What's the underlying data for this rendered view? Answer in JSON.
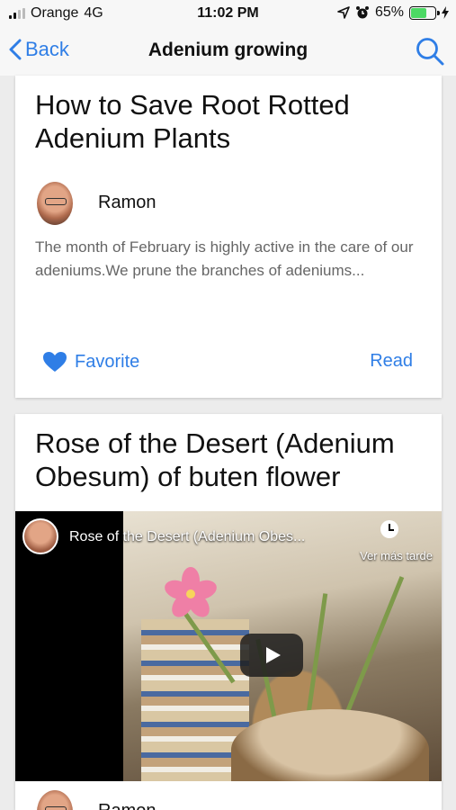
{
  "status_bar": {
    "carrier": "Orange",
    "network": "4G",
    "time": "11:02 PM",
    "battery_percent": "65%",
    "battery_level": 0.65
  },
  "nav": {
    "back_label": "Back",
    "title": "Adenium growing",
    "accent_color": "#2f7ee6"
  },
  "articles": [
    {
      "title": "How to Save Root Rotted Adenium Plants",
      "author": "Ramon",
      "excerpt": "The month of February is highly active in the care of our adeniums.We prune the branches of adeniums...",
      "favorite_label": "Favorite",
      "read_label": "Read"
    },
    {
      "title": "Rose of the Desert (Adenium Obesum) of buten flower",
      "video": {
        "title": "Rose of the Desert (Adenium Obes...",
        "watch_later": "Ver más tarde"
      },
      "author": "Ramon"
    }
  ]
}
